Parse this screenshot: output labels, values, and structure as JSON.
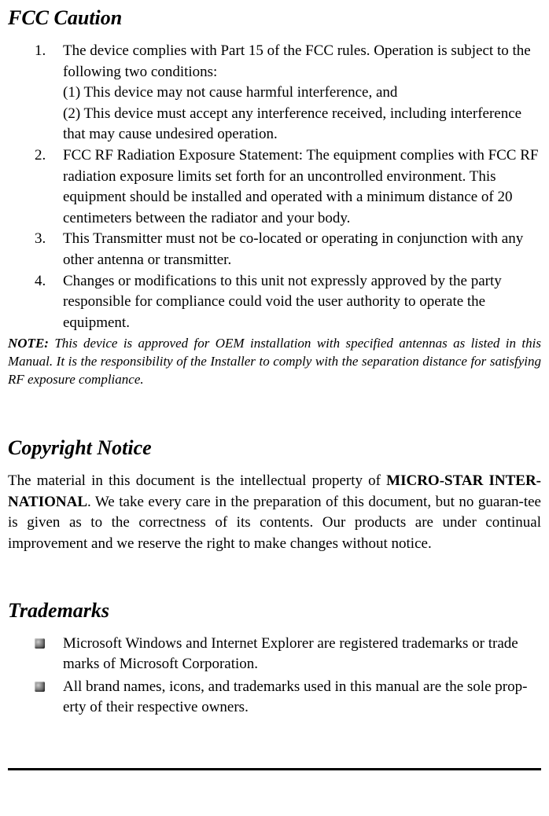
{
  "fcc": {
    "title": "FCC Caution",
    "items": [
      {
        "num": "1.",
        "text": "The device complies with Part 15 of the FCC rules. Operation is subject to the following two conditions:\n(1) This device may not cause harmful interference, and\n(2) This device must accept any interference received, including interference that may cause undesired operation."
      },
      {
        "num": "2.",
        "text": "FCC RF Radiation Exposure Statement: The equipment complies with FCC RF radiation exposure limits set forth for an uncontrolled environment. This equipment should be installed and operated with a minimum distance of 20 centimeters between the radiator and your body."
      },
      {
        "num": "3.",
        "text": "This Transmitter must not be co-located or operating in conjunction with any other antenna or transmitter."
      },
      {
        "num": "4.",
        "text": "Changes or modifications to this unit not expressly approved by the party responsible for compliance could void the user authority to operate the equipment."
      }
    ],
    "note_label": "NOTE:",
    "note_text": " This device is approved for OEM installation with specified antennas as listed in this Manual.  It is the responsibility of the Installer to comply with the separation distance for satisfying RF exposure compliance."
  },
  "copyright": {
    "title": "Copyright Notice",
    "text_before": "The material in this document is the intellectual property of ",
    "bold": "MICRO-STAR INTER-NATIONAL",
    "text_after": ".  We take every care in the preparation of this document, but no guaran-tee is given as to the correctness of its contents.  Our products are under continual improvement and we reserve the right to make changes without notice."
  },
  "trademarks": {
    "title": "Trademarks",
    "items": [
      "Microsoft Windows and Internet Explorer are registered trademarks or trade marks of Microsoft Corporation.",
      "All brand names, icons, and trademarks used in this manual are the sole prop-erty of their respective owners."
    ]
  }
}
